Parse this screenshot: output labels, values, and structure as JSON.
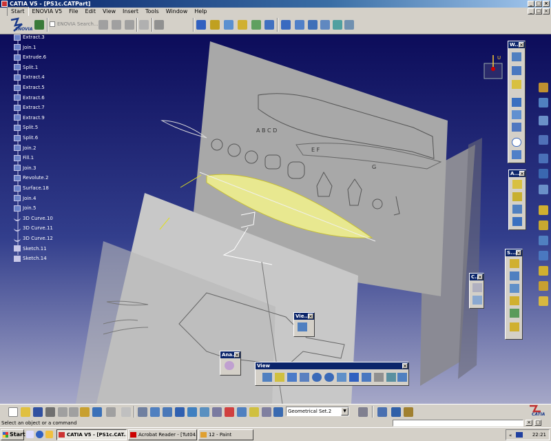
{
  "window": {
    "title": "CATIA V5 - [PS1c.CATPart]"
  },
  "menu": [
    "Start",
    "ENOVIA V5",
    "File",
    "Edit",
    "View",
    "Insert",
    "Tools",
    "Window",
    "Help"
  ],
  "toolbar": {
    "enovia_label": "ENOVIA",
    "enovia_search": "ENOVIA Search..."
  },
  "tree": [
    {
      "label": "Extract.3",
      "kind": "feat"
    },
    {
      "label": "Join.1",
      "kind": "feat"
    },
    {
      "label": "Extrude.6",
      "kind": "feat"
    },
    {
      "label": "Split.1",
      "kind": "feat"
    },
    {
      "label": "Extract.4",
      "kind": "feat"
    },
    {
      "label": "Extract.5",
      "kind": "feat"
    },
    {
      "label": "Extract.6",
      "kind": "feat"
    },
    {
      "label": "Extract.7",
      "kind": "feat"
    },
    {
      "label": "Extract.9",
      "kind": "feat"
    },
    {
      "label": "Split.5",
      "kind": "feat"
    },
    {
      "label": "Split.6",
      "kind": "feat"
    },
    {
      "label": "Join.2",
      "kind": "feat"
    },
    {
      "label": "Fill.1",
      "kind": "feat"
    },
    {
      "label": "Join.3",
      "kind": "feat"
    },
    {
      "label": "Revolute.2",
      "kind": "feat"
    },
    {
      "label": "Surface.18",
      "kind": "feat"
    },
    {
      "label": "Join.4",
      "kind": "feat"
    },
    {
      "label": "Join.5",
      "kind": "feat"
    },
    {
      "label": "3D Curve.10",
      "kind": "curve"
    },
    {
      "label": "3D Curve.11",
      "kind": "curve"
    },
    {
      "label": "3D Curve.12",
      "kind": "curve"
    },
    {
      "label": "Sketch.11",
      "kind": "sketch"
    },
    {
      "label": "Sketch.14",
      "kind": "sketch"
    }
  ],
  "floating_toolbars": {
    "view_small": "Vie...",
    "analysis": "Ana...",
    "view_main": "View",
    "wireframe": "W...",
    "surfaces": "A...",
    "operations": "S...",
    "constraints": "C..."
  },
  "compass": {
    "axis_label": "U"
  },
  "bottom_toolbar": {
    "geometrical_set": "Geometrical Set.2"
  },
  "brand": "CATIA",
  "status": {
    "message": "Select an object or a command"
  },
  "taskbar": {
    "start": "Start",
    "tasks": [
      "CATIA V5 - [PS1c.CAT...",
      "Acrobat Reader - [Tut04...",
      "12 - Paint"
    ],
    "clock": "22:21"
  },
  "colors": {
    "title_bar": "#0a246a",
    "viewport_top": "#0c0c5a",
    "viewport_bottom": "#a6a8c8",
    "highlight_surface": "#e8e890",
    "toolbar_bg": "#d4d0c8"
  }
}
